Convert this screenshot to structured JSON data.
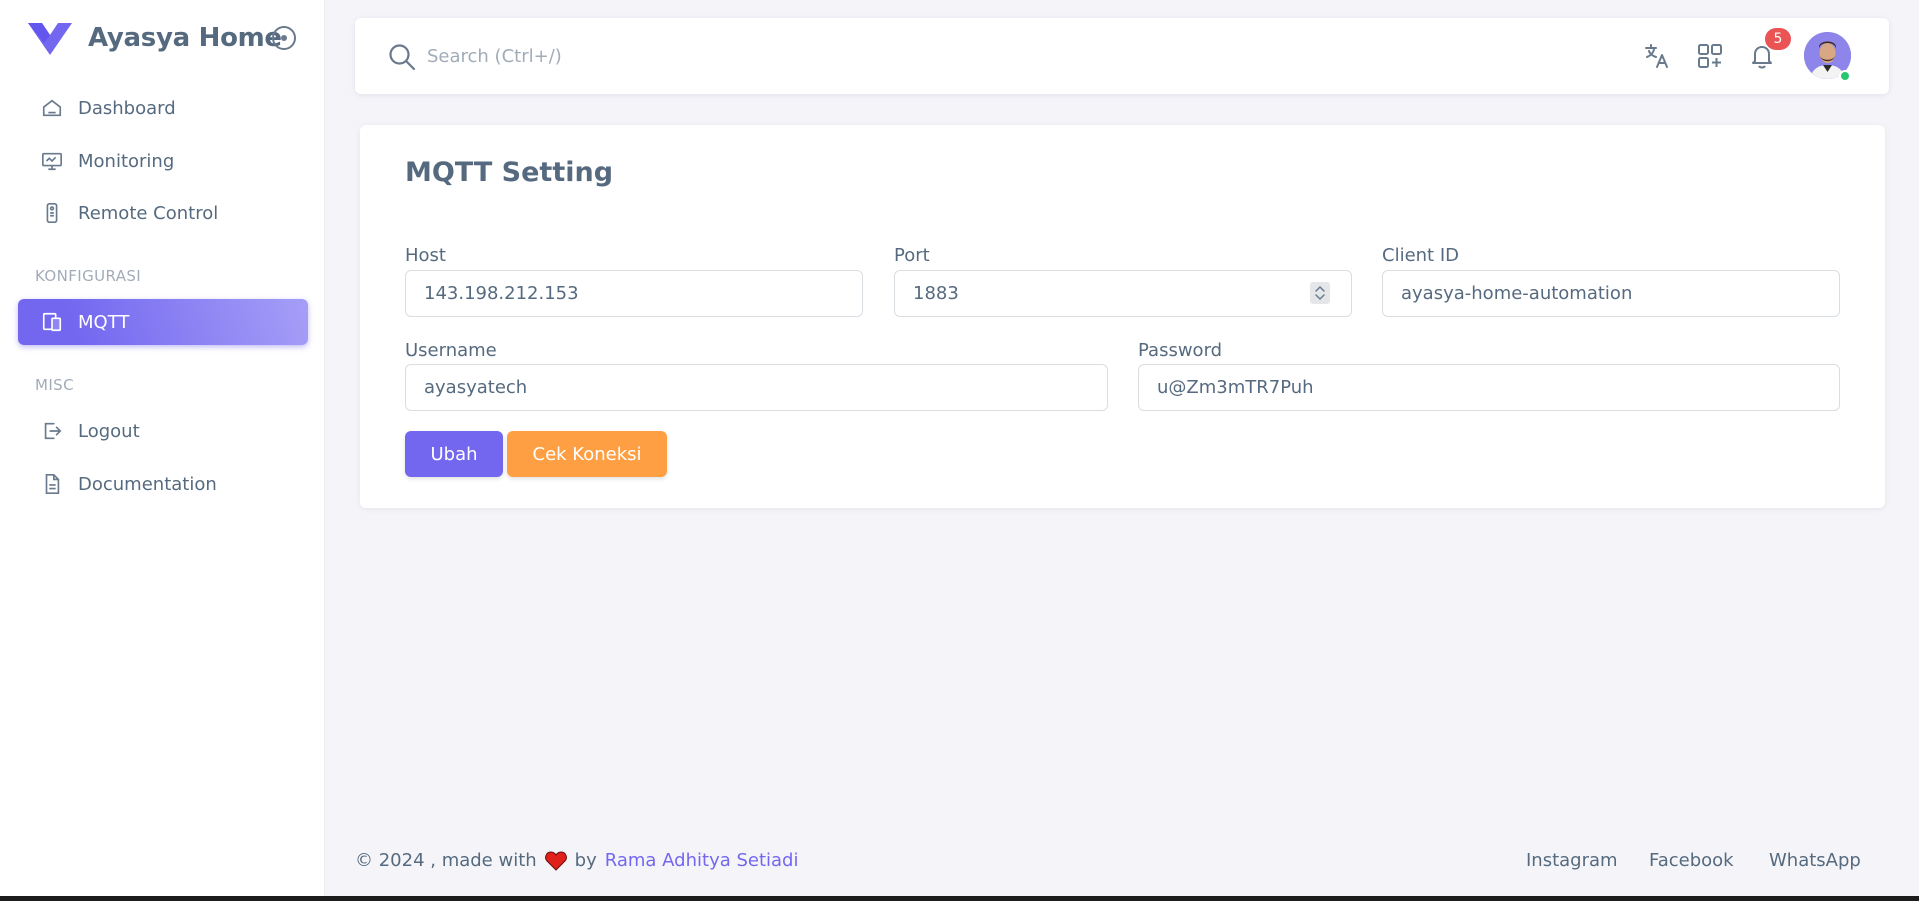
{
  "brand": {
    "name": "Ayasya Home",
    "accent": "#7367f0"
  },
  "sidebar": {
    "items": [
      {
        "label": "Dashboard",
        "icon": "home-icon"
      },
      {
        "label": "Monitoring",
        "icon": "monitor-icon"
      },
      {
        "label": "Remote Control",
        "icon": "remote-icon"
      }
    ],
    "section_config": "KONFIGURASI",
    "config_items": [
      {
        "label": "MQTT",
        "icon": "devices-icon",
        "active": true
      }
    ],
    "section_misc": "MISC",
    "misc_items": [
      {
        "label": "Logout",
        "icon": "logout-icon"
      },
      {
        "label": "Documentation",
        "icon": "file-icon"
      }
    ]
  },
  "navbar": {
    "search_placeholder": "Search (Ctrl+/)",
    "notification_count": "5",
    "icons": [
      "translate-icon",
      "apps-add-icon",
      "bell-icon"
    ]
  },
  "form": {
    "title": "MQTT Setting",
    "host_label": "Host",
    "host_value": "143.198.212.153",
    "port_label": "Port",
    "port_value": "1883",
    "client_label": "Client ID",
    "client_value": "ayasya-home-automation",
    "username_label": "Username",
    "username_value": "ayasyatech",
    "password_label": "Password",
    "password_value": "u@Zm3mTR7Puh",
    "save_label": "Ubah",
    "check_label": "Cek Koneksi"
  },
  "footer": {
    "copyright_pre": "© 2024 , made with",
    "by": "by",
    "author": "Rama Adhitya Setiadi",
    "links": [
      "Instagram",
      "Facebook",
      "WhatsApp"
    ]
  },
  "colors": {
    "primary": "#7367f0",
    "warning": "#ff9f43",
    "danger": "#ea5455",
    "success": "#28c76f"
  }
}
